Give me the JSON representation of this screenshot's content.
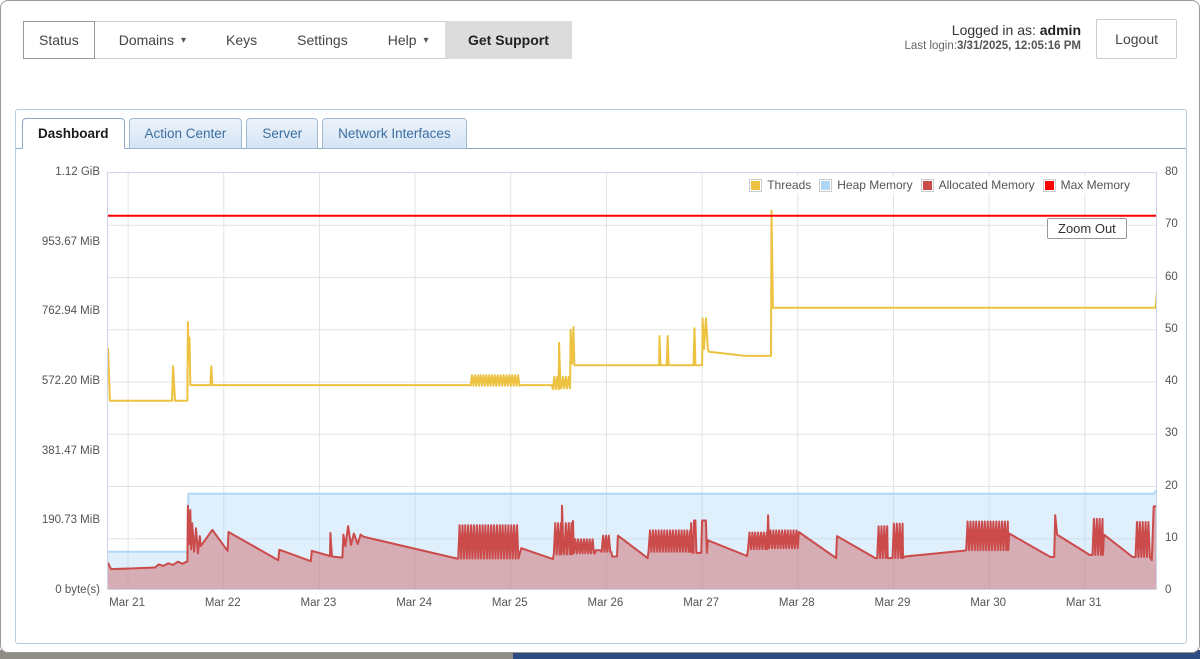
{
  "top_nav": {
    "items": [
      {
        "label": "Status",
        "selected": true
      },
      {
        "label": "Domains",
        "caret": "▾"
      },
      {
        "label": "Keys"
      },
      {
        "label": "Settings"
      },
      {
        "label": "Help",
        "caret": "▾"
      }
    ],
    "get_support_label": "Get Support"
  },
  "session": {
    "logged_in_prefix": "Logged in as: ",
    "username": "admin",
    "last_login_prefix": "Last login:",
    "last_login_value": "3/31/2025, 12:05:16 PM",
    "logout_label": "Logout"
  },
  "tabs": [
    {
      "label": "Dashboard",
      "active": true
    },
    {
      "label": "Action Center"
    },
    {
      "label": "Server"
    },
    {
      "label": "Network Interfaces"
    }
  ],
  "chart_data": {
    "type": "line",
    "title": "",
    "x_domain": [
      20.79,
      31.765
    ],
    "x_ticks": [
      {
        "day": 21,
        "label": "Mar 21"
      },
      {
        "day": 22,
        "label": "Mar 22"
      },
      {
        "day": 23,
        "label": "Mar 23"
      },
      {
        "day": 24,
        "label": "Mar 24"
      },
      {
        "day": 25,
        "label": "Mar 25"
      },
      {
        "day": 26,
        "label": "Mar 26"
      },
      {
        "day": 27,
        "label": "Mar 27"
      },
      {
        "day": 28,
        "label": "Mar 28"
      },
      {
        "day": 29,
        "label": "Mar 29"
      },
      {
        "day": 30,
        "label": "Mar 30"
      },
      {
        "day": 31,
        "label": "Mar 31"
      }
    ],
    "left_axis": {
      "labels": [
        "0 byte(s)",
        "190.73 MiB",
        "381.47 MiB",
        "572.20 MiB",
        "762.94 MiB",
        "953.67 MiB",
        "1.12 GiB"
      ]
    },
    "right_axis": {
      "min": 0,
      "max": 80,
      "step": 10
    },
    "grid_color": "#e3e3e3",
    "legend": [
      {
        "name": "Threads",
        "color": "#edc240"
      },
      {
        "name": "Heap Memory",
        "color": "#afd8f8"
      },
      {
        "name": "Allocated Memory",
        "color": "#cb4b4b"
      },
      {
        "name": "Max Memory",
        "color": "#ff0000"
      }
    ],
    "zoom_out_label": "Zoom Out",
    "series": [
      {
        "name": "Heap Memory",
        "color": "#afd8f8",
        "width": 2,
        "fill": 0.4,
        "points": [
          [
            20.79,
            7.5
          ],
          [
            21.62,
            7.5
          ],
          [
            21.63,
            18.6
          ],
          [
            31.72,
            18.6
          ],
          [
            31.765,
            19.7
          ]
        ]
      },
      {
        "name": "Allocated Memory",
        "color": "#cb4b4b",
        "width": 2,
        "fill": 0.4,
        "points": [
          [
            20.79,
            5.4
          ],
          [
            20.82,
            4.2
          ],
          [
            21.02,
            4.3
          ],
          [
            21.28,
            4.5
          ],
          [
            21.32,
            5.1
          ],
          [
            21.37,
            4.8
          ],
          [
            21.42,
            5.3
          ],
          [
            21.47,
            5.0
          ],
          [
            21.52,
            5.6
          ],
          [
            21.57,
            5.2
          ],
          [
            21.61,
            5.6
          ],
          [
            21.62,
            5.6
          ],
          [
            21.625,
            16.3
          ],
          [
            21.64,
            9.0
          ],
          [
            21.65,
            15.5
          ],
          [
            21.66,
            8.0
          ],
          [
            21.67,
            13.0
          ],
          [
            21.69,
            7.5
          ],
          [
            21.71,
            12.0
          ],
          [
            21.73,
            7.2
          ],
          [
            21.75,
            10.5
          ],
          [
            21.76,
            8.6
          ],
          [
            21.88,
            11.7
          ],
          [
            22.04,
            7.7
          ],
          [
            22.05,
            11.3
          ],
          [
            22.57,
            5.9
          ],
          [
            22.58,
            7.9
          ],
          [
            22.91,
            5.7
          ],
          [
            22.92,
            7.7
          ],
          [
            23.11,
            6.7
          ],
          [
            23.115,
            11.1
          ],
          [
            23.13,
            6.6
          ],
          [
            23.24,
            6.4
          ],
          [
            23.25,
            10.8
          ],
          [
            23.27,
            8.6
          ],
          [
            23.3,
            12.4
          ],
          [
            23.33,
            8.8
          ],
          [
            23.36,
            11.0
          ],
          [
            23.4,
            9.0
          ],
          [
            23.43,
            10.8
          ],
          [
            23.46,
            10.4
          ],
          [
            24.44,
            6.2
          ],
          {
            "b": [
              24.45,
              25.08,
              6.2,
              12.6
            ]
          },
          [
            25.11,
            8.2
          ],
          [
            25.44,
            6.1
          ],
          {
            "b": [
              25.45,
              25.53,
              7.0,
              13.0
            ]
          },
          [
            25.535,
            16.3
          ],
          [
            25.55,
            8.0
          ],
          {
            "b": [
              25.56,
              25.64,
              7.0,
              13.0
            ]
          },
          [
            25.65,
            13.4
          ],
          {
            "b": [
              25.66,
              25.88,
              7.2,
              9.9
            ]
          },
          [
            25.89,
            7.8
          ],
          [
            25.94,
            7.8
          ],
          {
            "b": [
              25.95,
              26.05,
              7.5,
              10.6
            ]
          },
          [
            26.06,
            6.6
          ],
          [
            26.11,
            6.6
          ],
          [
            26.12,
            10.6
          ],
          [
            26.43,
            6.3
          ],
          {
            "b": [
              26.44,
              26.88,
              7.5,
              11.6
            ]
          },
          [
            26.885,
            13.0
          ],
          [
            26.9,
            7.3
          ],
          [
            26.91,
            7.3
          ],
          [
            26.915,
            13.5
          ],
          [
            26.93,
            13.5
          ],
          [
            26.94,
            7.3
          ],
          [
            26.99,
            7.3
          ],
          [
            27.0,
            13.5
          ],
          [
            27.04,
            13.5
          ],
          [
            27.05,
            7.3
          ],
          [
            27.06,
            9.7
          ],
          [
            27.47,
            6.7
          ],
          {
            "b": [
              27.48,
              27.68,
              8.0,
              11.2
            ]
          },
          [
            27.69,
            14.5
          ],
          {
            "b": [
              27.7,
              28.0,
              8.2,
              11.6
            ]
          },
          [
            28.01,
            11.3
          ],
          [
            28.4,
            6.3
          ],
          [
            28.41,
            10.5
          ],
          [
            28.81,
            6.3
          ],
          {
            "b": [
              28.83,
              28.94,
              6.3,
              12.4
            ]
          },
          [
            28.95,
            6.3
          ],
          {
            "b": [
              28.99,
              29.1,
              6.3,
              12.9
            ]
          },
          [
            29.12,
            6.6
          ],
          [
            29.73,
            7.7
          ],
          {
            "b": [
              29.76,
              30.2,
              7.8,
              13.3
            ]
          },
          [
            30.21,
            11.0
          ],
          [
            30.64,
            6.5
          ],
          [
            30.68,
            6.5
          ],
          [
            30.69,
            14.5
          ],
          [
            30.71,
            10.8
          ],
          [
            31.05,
            6.9
          ],
          {
            "b": [
              31.08,
              31.19,
              6.9,
              13.8
            ]
          },
          [
            31.2,
            10.8
          ],
          [
            31.5,
            6.5
          ],
          {
            "b": [
              31.53,
              31.68,
              6.5,
              13.2
            ]
          },
          [
            31.7,
            5.9
          ],
          [
            31.72,
            16.2
          ],
          [
            31.765,
            16.2
          ]
        ]
      },
      {
        "name": "Threads",
        "color": "#edc240",
        "width": 2,
        "points": [
          [
            20.79,
            46.5
          ],
          [
            20.81,
            36.4
          ],
          [
            21.46,
            36.4
          ],
          [
            21.47,
            43
          ],
          [
            21.49,
            36.4
          ],
          [
            21.62,
            36.4
          ],
          [
            21.625,
            51.5
          ],
          [
            21.635,
            44
          ],
          [
            21.642,
            48.5
          ],
          [
            21.65,
            39.4
          ],
          [
            21.86,
            39.4
          ],
          [
            21.87,
            43
          ],
          [
            21.88,
            39.4
          ],
          [
            24.57,
            39.4
          ],
          {
            "b": [
              24.58,
              25.1,
              39.3,
              41.3
            ]
          },
          [
            25.11,
            39.4
          ],
          [
            25.43,
            39.4
          ],
          {
            "b": [
              25.44,
              25.5,
              38.6,
              41
            ]
          },
          [
            25.505,
            47.5
          ],
          [
            25.52,
            38.8
          ],
          {
            "b": [
              25.53,
              25.62,
              38.8,
              41
            ]
          },
          [
            25.625,
            50
          ],
          [
            25.64,
            43.5
          ],
          [
            25.655,
            50.5
          ],
          [
            25.665,
            43.2
          ],
          [
            26.55,
            43.2
          ],
          [
            26.555,
            48.8
          ],
          [
            26.565,
            43.2
          ],
          [
            26.63,
            43.2
          ],
          [
            26.64,
            48.8
          ],
          [
            26.65,
            43.2
          ],
          [
            26.91,
            43.2
          ],
          [
            26.92,
            50.3
          ],
          [
            26.93,
            43.2
          ],
          [
            27.0,
            43.2
          ],
          [
            27.005,
            52.2
          ],
          [
            27.02,
            46.3
          ],
          [
            27.04,
            52.2
          ],
          [
            27.06,
            46.2
          ],
          [
            27.07,
            45.8
          ],
          [
            27.45,
            45.0
          ],
          [
            27.72,
            45.0
          ],
          [
            27.725,
            72.8
          ],
          [
            27.74,
            54.2
          ],
          [
            31.74,
            54.2
          ],
          [
            31.765,
            59.8
          ]
        ]
      },
      {
        "name": "Max Memory",
        "color": "#ff0000",
        "width": 2,
        "points": [
          [
            20.79,
            71.8
          ],
          [
            31.765,
            71.8
          ]
        ]
      }
    ]
  }
}
